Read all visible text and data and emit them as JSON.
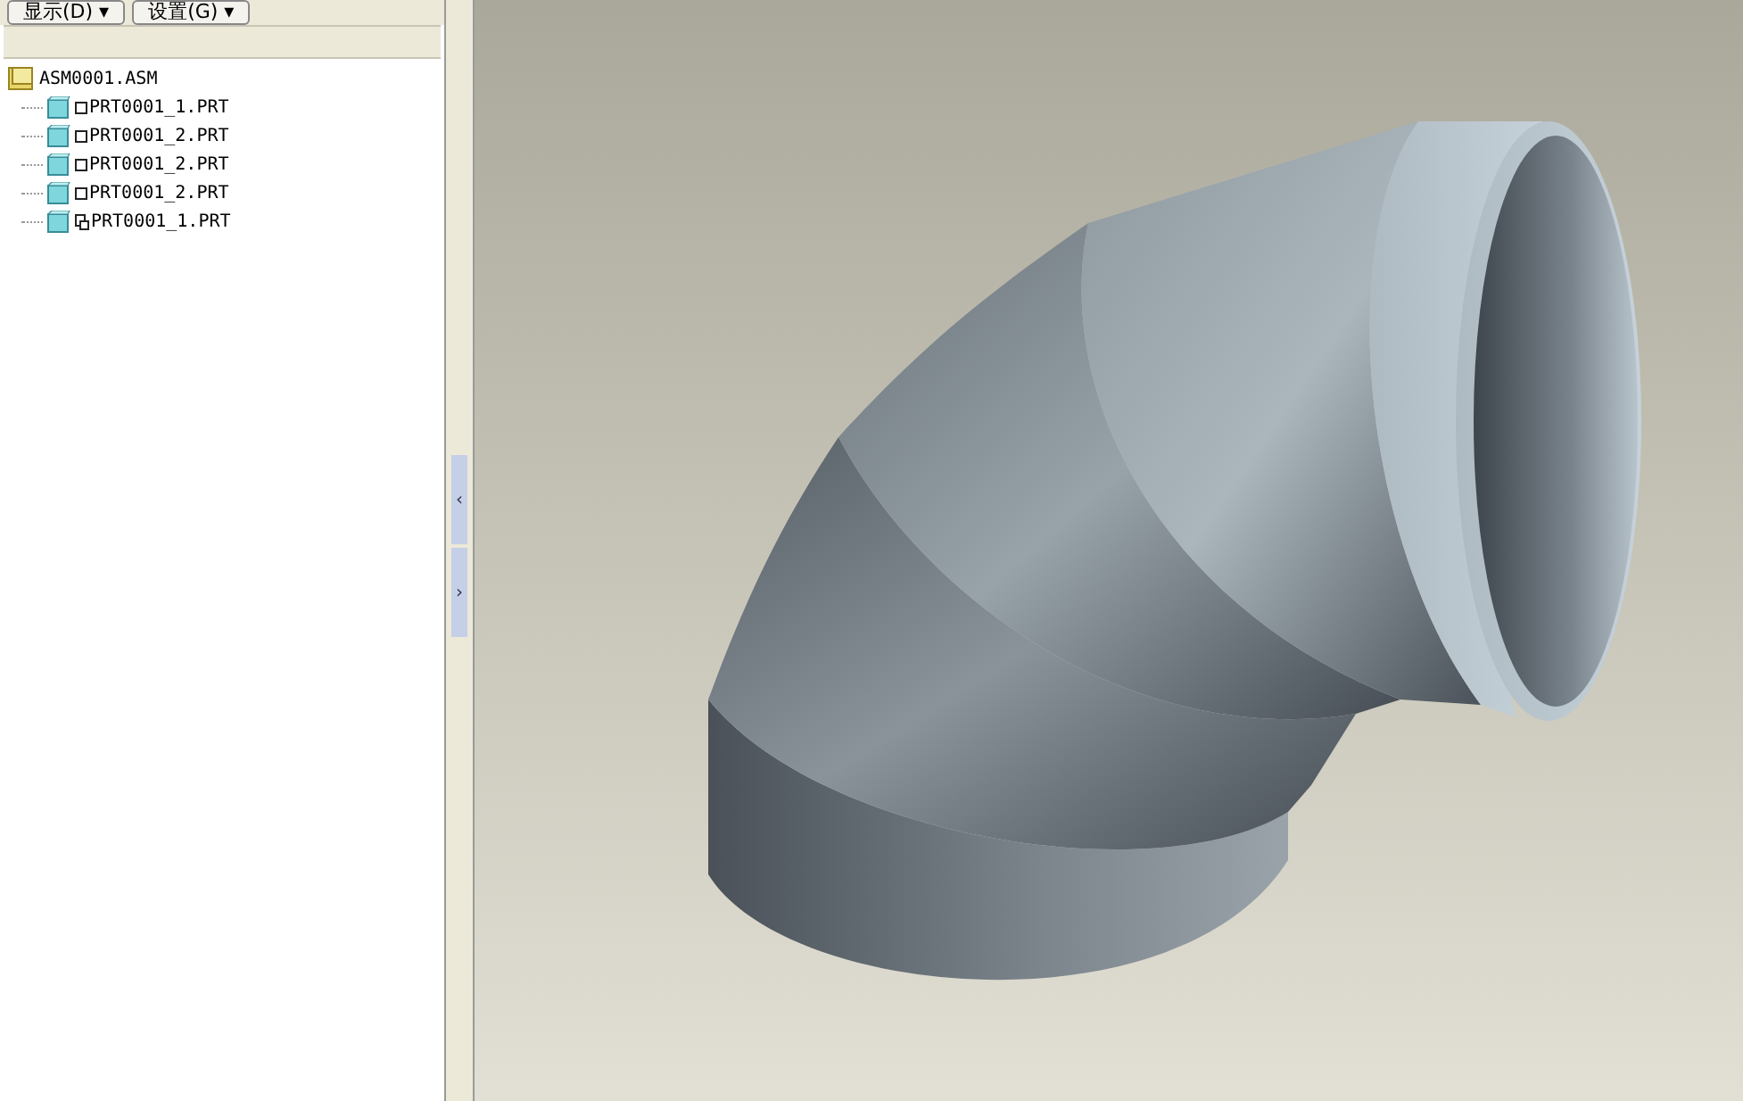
{
  "toolbar": {
    "buttons": [
      {
        "label": "显示(D)",
        "caret": "▾"
      },
      {
        "label": "设置(G)",
        "caret": "▾"
      }
    ]
  },
  "model_tree": {
    "root": {
      "label": "ASM0001.ASM",
      "children": [
        {
          "label": "PRT0001_1.PRT",
          "kind": "part"
        },
        {
          "label": "PRT0001_2.PRT",
          "kind": "part"
        },
        {
          "label": "PRT0001_2.PRT",
          "kind": "part"
        },
        {
          "label": "PRT0001_2.PRT",
          "kind": "part"
        },
        {
          "label": "PRT0001_1.PRT",
          "kind": "linked"
        }
      ]
    }
  },
  "splitter": {
    "buttons": [
      {
        "glyph": "‹"
      },
      {
        "glyph": "›"
      }
    ]
  }
}
